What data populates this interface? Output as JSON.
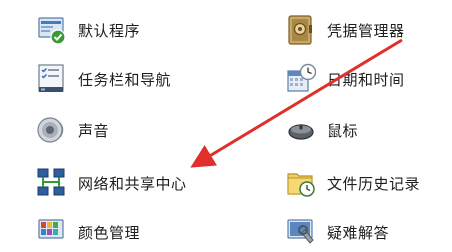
{
  "items": [
    {
      "label": "默认程序",
      "icon": "default-programs-icon"
    },
    {
      "label": "凭据管理器",
      "icon": "credential-manager-icon"
    },
    {
      "label": "任务栏和导航",
      "icon": "taskbar-navigation-icon"
    },
    {
      "label": "日期和时间",
      "icon": "date-time-icon"
    },
    {
      "label": "声音",
      "icon": "sound-icon"
    },
    {
      "label": "鼠标",
      "icon": "mouse-icon"
    },
    {
      "label": "网络和共享中心",
      "icon": "network-sharing-icon"
    },
    {
      "label": "文件历史记录",
      "icon": "file-history-icon"
    },
    {
      "label": "颜色管理",
      "icon": "color-management-icon"
    },
    {
      "label": "疑难解答",
      "icon": "troubleshooting-icon"
    }
  ],
  "annotation": {
    "arrow_color": "#e0302b"
  }
}
